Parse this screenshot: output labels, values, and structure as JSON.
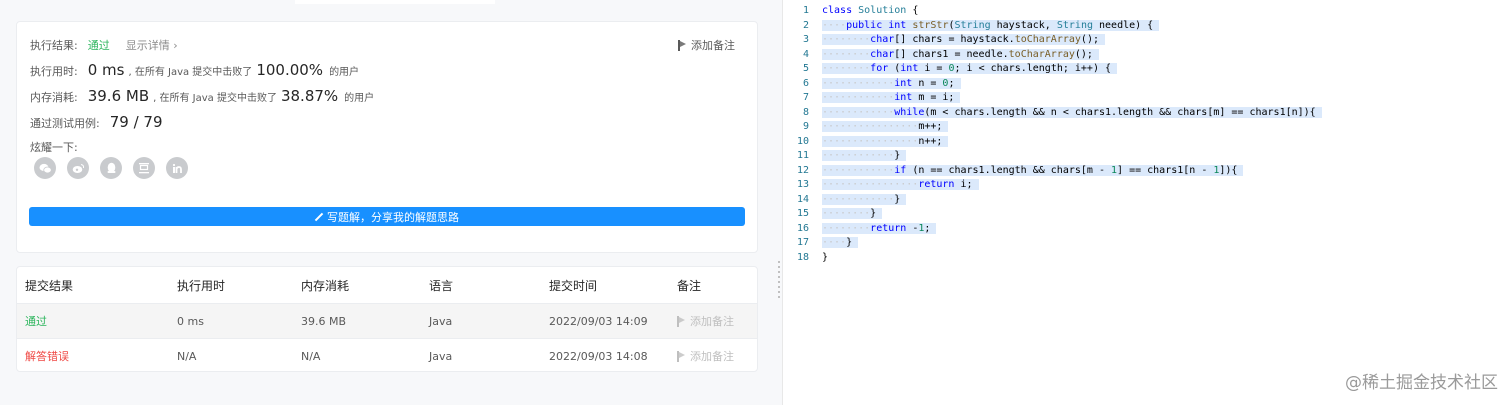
{
  "result": {
    "status_label": "执行结果:",
    "status_value": "通过",
    "details_link": "显示详情 ›",
    "add_note": "添加备注",
    "runtime_label": "执行用时:",
    "runtime_value": "0 ms",
    "runtime_text": ", 在所有 Java 提交中击败了",
    "runtime_pct": "100.00%",
    "runtime_users": "的用户",
    "memory_label": "内存消耗:",
    "memory_value": "39.6 MB",
    "memory_text": ", 在所有 Java 提交中击败了",
    "memory_pct": "38.87%",
    "memory_users": "的用户",
    "tests_label": "通过测试用例:",
    "tests_value": "79 / 79",
    "share_label": "炫耀一下:",
    "share_icons": [
      "wechat-icon",
      "weibo-icon",
      "qq-icon",
      "douban-icon",
      "linkedin-icon"
    ],
    "solution_button": "写题解，分享我的解题思路"
  },
  "submissions": {
    "headers": [
      "提交结果",
      "执行用时",
      "内存消耗",
      "语言",
      "提交时间",
      "备注"
    ],
    "rows": [
      {
        "status": "通过",
        "runtime": "0 ms",
        "memory": "39.6 MB",
        "language": "Java",
        "time": "2022/09/03 14:09",
        "note": "添加备注"
      },
      {
        "status": "解答错误",
        "runtime": "N/A",
        "memory": "N/A",
        "language": "Java",
        "time": "2022/09/03 14:08",
        "note": "添加备注"
      }
    ]
  },
  "editor": {
    "line_numbers": [
      "1",
      "2",
      "3",
      "4",
      "5",
      "6",
      "7",
      "8",
      "9",
      "10",
      "11",
      "12",
      "13",
      "14",
      "15",
      "16",
      "17",
      "18"
    ]
  },
  "watermark": "@稀土掘金技术社区",
  "colors": {
    "pass": "#2db55d",
    "fail": "#ef4743",
    "primary": "#1890ff"
  }
}
